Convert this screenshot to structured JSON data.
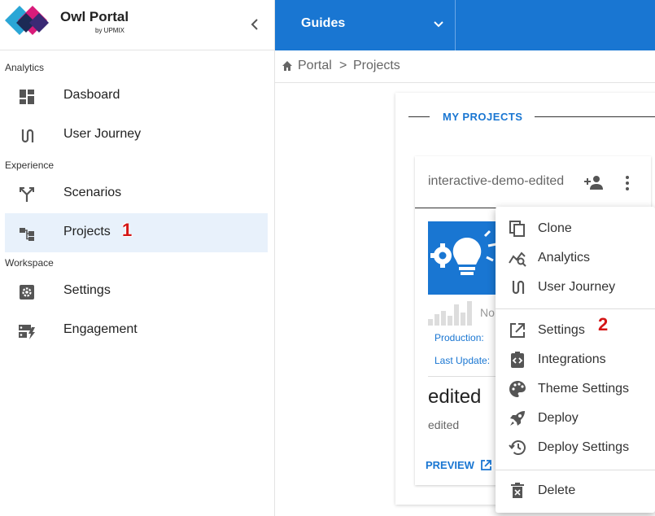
{
  "brand": {
    "name": "Owl Portal",
    "sub": "by UPMIX"
  },
  "sidebar": {
    "sections": [
      {
        "label": "Analytics",
        "items": [
          {
            "label": "Dasboard",
            "icon": "dashboard-icon"
          },
          {
            "label": "User Journey",
            "icon": "route-icon"
          }
        ]
      },
      {
        "label": "Experience",
        "items": [
          {
            "label": "Scenarios",
            "icon": "merge-icon"
          },
          {
            "label": "Projects",
            "icon": "hierarchy-icon",
            "active": true
          }
        ]
      },
      {
        "label": "Workspace",
        "items": [
          {
            "label": "Settings",
            "icon": "settings-box-icon"
          },
          {
            "label": "Engagement",
            "icon": "engagement-icon"
          }
        ]
      }
    ]
  },
  "topbar": {
    "guides_label": "Guides"
  },
  "breadcrumb": {
    "root": "Portal",
    "sep": ">",
    "current": "Projects"
  },
  "main": {
    "section_title": "MY PROJECTS",
    "card": {
      "title": "interactive-demo-edited",
      "status_text": "No",
      "production_label": "Production:",
      "last_update_label": "Last Update:",
      "name": "edited",
      "description": "edited",
      "preview_label": "PREVIEW"
    }
  },
  "menu": {
    "items": [
      {
        "label": "Clone",
        "icon": "copy-icon"
      },
      {
        "label": "Analytics",
        "icon": "analytics-icon"
      },
      {
        "label": "User Journey",
        "icon": "route-icon"
      },
      {
        "label": "Settings",
        "icon": "open-external-icon"
      },
      {
        "label": "Integrations",
        "icon": "code-clipboard-icon"
      },
      {
        "label": "Theme Settings",
        "icon": "palette-icon"
      },
      {
        "label": "Deploy",
        "icon": "rocket-icon"
      },
      {
        "label": "Deploy Settings",
        "icon": "history-icon"
      },
      {
        "label": "Delete",
        "icon": "delete-icon"
      }
    ]
  },
  "annotations": {
    "marker_1": "1",
    "marker_2": "2"
  },
  "colors": {
    "accent": "#1976d2",
    "active_bg": "#e8f1fb",
    "marker": "#d41616"
  }
}
